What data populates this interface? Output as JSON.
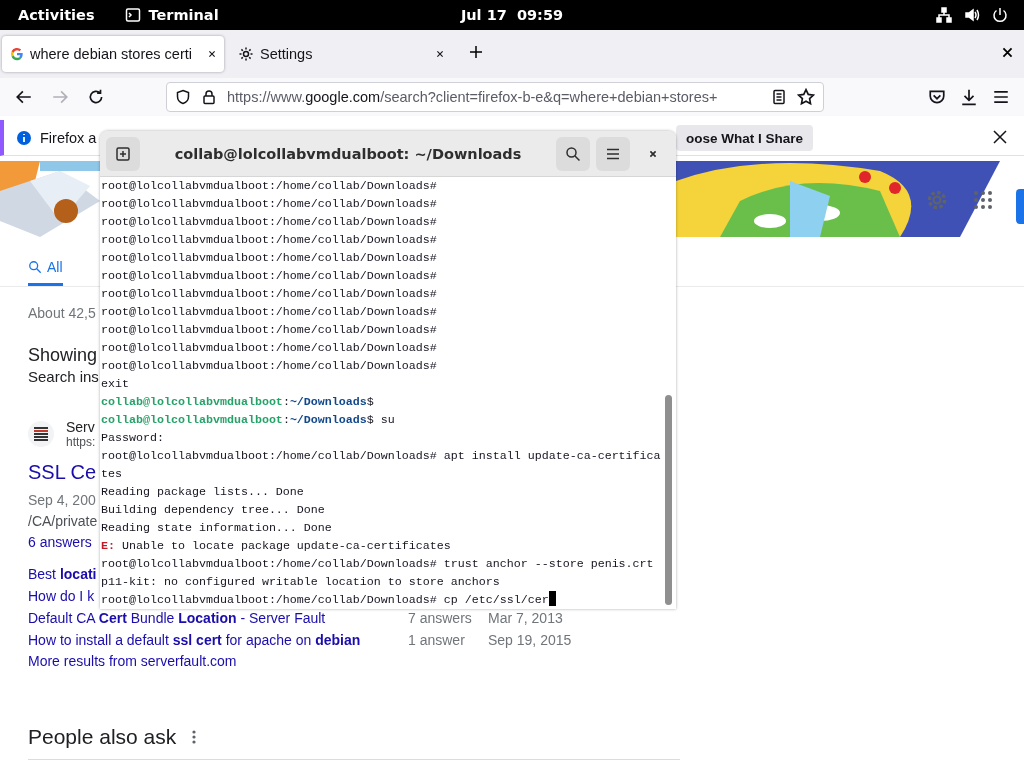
{
  "top_bar": {
    "activities": "Activities",
    "app": "Terminal",
    "clock": "Jul 17  09:59"
  },
  "browser": {
    "tabs": [
      {
        "title": "where debian stores certi",
        "selected": true
      },
      {
        "title": "Settings",
        "selected": false
      }
    ],
    "url": {
      "prefix": "https://www.",
      "host": "google.com",
      "path": "/search?client=firefox-b-e&q=where+debian+stores+"
    },
    "notification": {
      "text": "Firefox a",
      "button": "oose What I Share"
    },
    "search_tabs": [
      {
        "label": "All",
        "selected": true
      }
    ],
    "result_count": "About 42,5",
    "showing": "Showing",
    "search_instead": "Search ins",
    "result": {
      "site": "Serv",
      "url": "https:",
      "title": "SSL Ce",
      "date": "Sep 4, 200",
      "snippet": "/CA/private",
      "answers": "6 answers"
    },
    "related": [
      {
        "title": "Best **locati**"
      },
      {
        "title": "How do I k"
      },
      {
        "title": "Default CA **Cert** Bundle **Location** - Server Fault",
        "answers": "7 answers",
        "date": "Mar 7, 2013"
      },
      {
        "title": "How to install a default **ssl cert** for apache on **debian**",
        "answers": "1 answer",
        "date": "Sep 19, 2015"
      }
    ],
    "more_results": "More results from serverfault.com",
    "people_also_ask": "People also ask"
  },
  "terminal": {
    "title": "collab@lolcollabvmdualboot: ~/Downloads",
    "lines": [
      {
        "text": "root@lolcollabvmdualboot:/home/collab/Downloads#"
      },
      {
        "text": "root@lolcollabvmdualboot:/home/collab/Downloads#"
      },
      {
        "text": "root@lolcollabvmdualboot:/home/collab/Downloads#"
      },
      {
        "text": "root@lolcollabvmdualboot:/home/collab/Downloads#"
      },
      {
        "text": "root@lolcollabvmdualboot:/home/collab/Downloads#"
      },
      {
        "text": "root@lolcollabvmdualboot:/home/collab/Downloads#"
      },
      {
        "text": "root@lolcollabvmdualboot:/home/collab/Downloads#"
      },
      {
        "text": "root@lolcollabvmdualboot:/home/collab/Downloads#"
      },
      {
        "text": "root@lolcollabvmdualboot:/home/collab/Downloads#"
      },
      {
        "text": "root@lolcollabvmdualboot:/home/collab/Downloads#"
      },
      {
        "text": "root@lolcollabvmdualboot:/home/collab/Downloads#"
      },
      {
        "text": "exit"
      },
      {
        "segments": [
          {
            "text": "collab@lolcollabvmdualboot",
            "kind": "user"
          },
          {
            "text": ":",
            "kind": "plain"
          },
          {
            "text": "~/Downloads",
            "kind": "path"
          },
          {
            "text": "$",
            "kind": "plain"
          }
        ]
      },
      {
        "segments": [
          {
            "text": "collab@lolcollabvmdualboot",
            "kind": "user"
          },
          {
            "text": ":",
            "kind": "plain"
          },
          {
            "text": "~/Downloads",
            "kind": "path"
          },
          {
            "text": "$ su",
            "kind": "plain"
          }
        ]
      },
      {
        "text": "Password:"
      },
      {
        "text": "root@lolcollabvmdualboot:/home/collab/Downloads# apt install update-ca-certifica"
      },
      {
        "text": "tes"
      },
      {
        "text": "Reading package lists... Done"
      },
      {
        "text": "Building dependency tree... Done"
      },
      {
        "text": "Reading state information... Done"
      },
      {
        "segments": [
          {
            "text": "E:",
            "kind": "error"
          },
          {
            "text": " Unable to locate package update-ca-certificates",
            "kind": "plain"
          }
        ]
      },
      {
        "text": "root@lolcollabvmdualboot:/home/collab/Downloads# trust anchor --store penis.crt"
      },
      {
        "text": "p11-kit: no configured writable location to store anchors"
      },
      {
        "text": "root@lolcollabvmdualboot:/home/collab/Downloads# cp /etc/ssl/cer",
        "cursor": true
      }
    ]
  }
}
